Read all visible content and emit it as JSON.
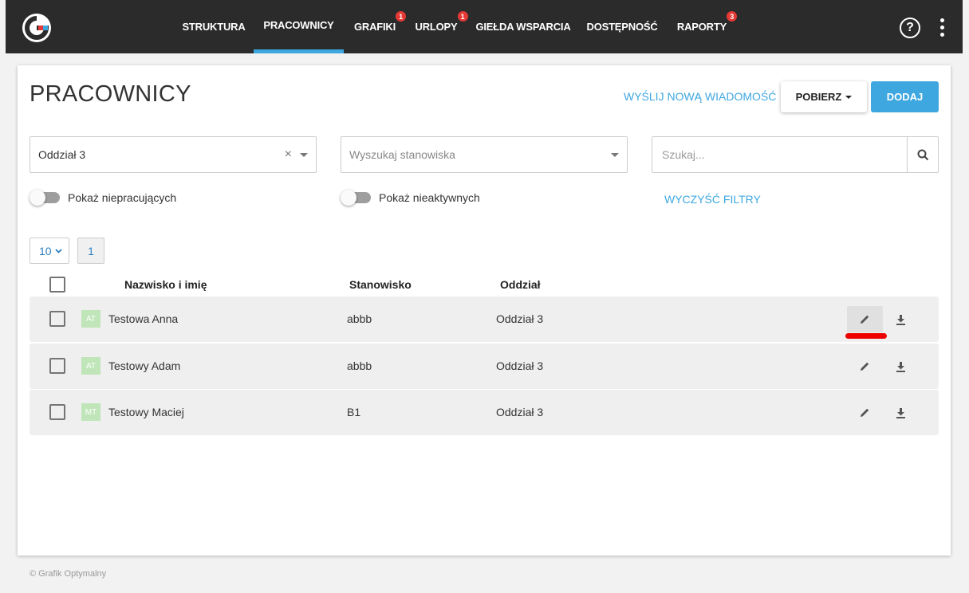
{
  "nav": {
    "items": [
      {
        "label": "STRUKTURA",
        "badge": null
      },
      {
        "label": "PRACOWNICY",
        "badge": null
      },
      {
        "label": "GRAFIKI",
        "badge": "1"
      },
      {
        "label": "URLOPY",
        "badge": "1"
      },
      {
        "label": "GIEŁDA WSPARCIA",
        "badge": null
      },
      {
        "label": "DOSTĘPNOŚĆ",
        "badge": null
      },
      {
        "label": "RAPORTY",
        "badge": "3"
      }
    ],
    "active": "PRACOWNICY",
    "help_glyph": "?"
  },
  "page": {
    "title": "PRACOWNICY",
    "send_message": "WYŚLIJ NOWĄ WIADOMOŚĆ",
    "download_label": "POBIERZ",
    "add_label": "DODAJ"
  },
  "filters": {
    "department_value": "Oddział 3",
    "position_placeholder": "Wyszukaj stanowiska",
    "search_placeholder": "Szukaj...",
    "toggle_nonworking": "Pokaż niepracujących",
    "toggle_inactive": "Pokaż nieaktywnych",
    "clear_filters": "WYCZYŚĆ FILTRY"
  },
  "pagination": {
    "page_size": "10",
    "current_page": "1"
  },
  "table": {
    "headers": {
      "name": "Nazwisko i imię",
      "position": "Stanowisko",
      "department": "Oddział"
    },
    "rows": [
      {
        "initials": "AT",
        "name": "Testowa Anna",
        "position": "abbb",
        "department": "Oddział 3"
      },
      {
        "initials": "AT",
        "name": "Testowy Adam",
        "position": "abbb",
        "department": "Oddział 3"
      },
      {
        "initials": "MT",
        "name": "Testowy Maciej",
        "position": "B1",
        "department": "Oddział 3"
      }
    ]
  },
  "footer": "© Grafik Optymalny",
  "colors": {
    "accent": "#3ea7e0",
    "topbar": "#2b2b2b",
    "badge": "#e53935",
    "annotation": "#e00000"
  }
}
